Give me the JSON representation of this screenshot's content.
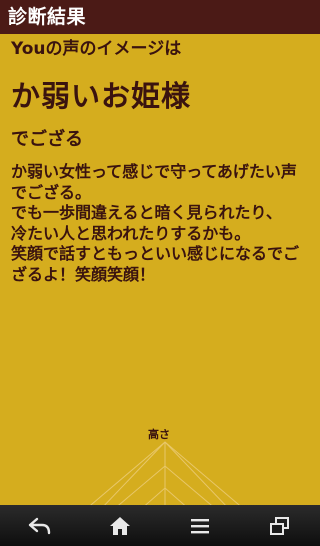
{
  "header": {
    "title": "診断結果"
  },
  "result": {
    "subtitle": "Youの声のイメージは",
    "title": "か弱いお姫様",
    "suffix": "でござる",
    "description": "か弱い女性って感じで守ってあげたい声でござる。\nでも一歩間違えると暗く見られたり、\n冷たい人と思われたりするかも。\n笑顔で話すともっといい感じになるでござるよ！笑顔笑顔！"
  },
  "chart": {
    "axis_label": "高さ"
  },
  "navbar": {
    "icons": [
      "back-icon",
      "home-icon",
      "menu-icon",
      "recent-apps-icon"
    ]
  },
  "colors": {
    "background": "#d5ad1e",
    "header": "#4b1a16",
    "text": "#3a130f"
  }
}
